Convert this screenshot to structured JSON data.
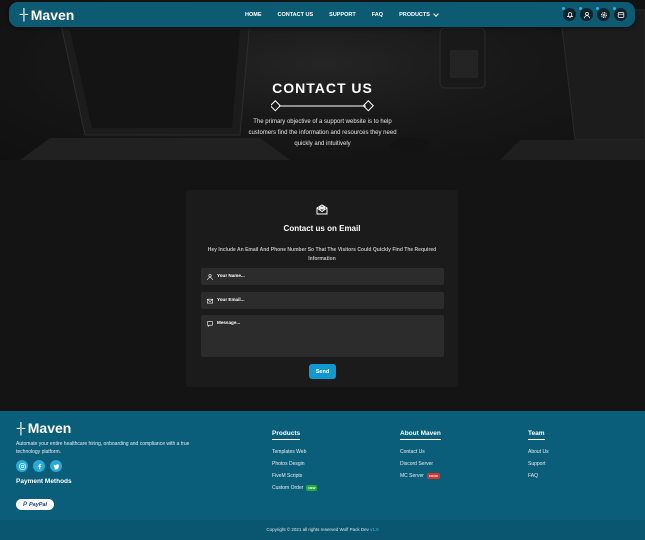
{
  "nav": {
    "brand": "Maven",
    "links": [
      "HOME",
      "CONTACT US",
      "SUPPORT",
      "FAQ",
      "PRODUCTS"
    ],
    "icons": [
      "bell-icon",
      "user-icon",
      "settings-icon",
      "wallet-icon"
    ]
  },
  "hero": {
    "title": "CONTACT US",
    "subtitle": "The primary objective of a support website is to help customers find the information and resources they need quickly and intuitively"
  },
  "contact_card": {
    "title": "Contact us on Email",
    "description": "Hey Include An Email And Phone Number So That The Visitors Could Quickly Find The Required Information",
    "name_placeholder": "Your Name...",
    "email_placeholder": "Your Email...",
    "message_placeholder": "Message...",
    "send_label": "Send"
  },
  "footer": {
    "brand": "Maven",
    "description": "Automate your entire healthcare hiring, onboarding and compliance with a true technology platform.",
    "payment_title": "Payment Methods",
    "paypal_label": "PayPal",
    "columns": [
      {
        "title": "Products",
        "items": [
          "Templates Web",
          "Photos Desgin",
          "FiveM Scripts",
          "Custom Order"
        ]
      },
      {
        "title": "About Maven",
        "items": [
          "Contact Us",
          "Discord Server",
          "MC Server"
        ]
      },
      {
        "title": "Team",
        "items": [
          "About Us",
          "Support",
          "FAQ"
        ]
      }
    ],
    "badges": {
      "custom_order": "NEW",
      "mc_server": "SOON"
    },
    "copyright_text": "Copyright © 2021 all rights reserved Wolf Pack Dev",
    "version": "v1.0"
  },
  "colors": {
    "nav_bg": "#0d5a73",
    "footer_bg": "#0b5e79",
    "accent": "#1099d1",
    "card_bg": "#1b1b1b"
  }
}
